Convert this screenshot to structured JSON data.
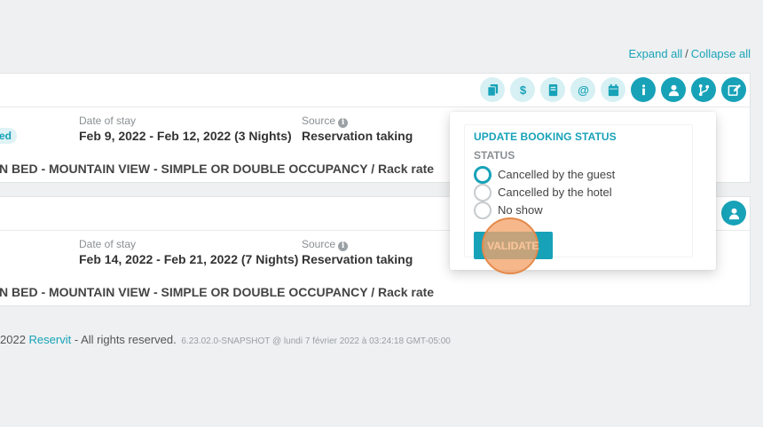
{
  "top_links": {
    "expand_all": "Expand all",
    "separator": "/",
    "collapse_all": "Collapse all"
  },
  "toolbar_icons": [
    "copy-icon",
    "dollar-icon",
    "book-icon",
    "at-icon",
    "calendar-icon",
    "info-icon",
    "user-icon",
    "branch-icon",
    "edit-icon"
  ],
  "reservations": [
    {
      "badge": "ed",
      "date_label": "Date of stay",
      "dates": "Feb 9, 2022 - Feb 12, 2022 (3 Nights)",
      "source_label": "Source",
      "source": "Reservation taking",
      "room": "N BED - MOUNTAIN VIEW - SIMPLE OR DOUBLE OCCUPANCY / Rack rate"
    },
    {
      "date_label": "Date of stay",
      "dates": "Feb 14, 2022 - Feb 21, 2022 (7 Nights)",
      "source_label": "Source",
      "source": "Reservation taking",
      "room": "N BED - MOUNTAIN VIEW - SIMPLE OR DOUBLE OCCUPANCY / Rack rate"
    }
  ],
  "footer": {
    "year": "2022",
    "brand": "Reservit",
    "rights": "- All rights reserved.",
    "version": "6.23.02.0-SNAPSHOT @ lundi 7 février 2022 à 03:24:18 GMT-05:00"
  },
  "popover": {
    "title": "UPDATE BOOKING STATUS",
    "status_label": "STATUS",
    "options": [
      {
        "label": "Cancelled by the guest",
        "checked": true
      },
      {
        "label": "Cancelled by the hotel",
        "checked": false
      },
      {
        "label": "No show",
        "checked": false
      }
    ],
    "validate_label": "VALIDATE"
  },
  "colors": {
    "accent": "#17a2b8",
    "accent_light": "#d6f0f3",
    "click_highlight": "#f4a36a"
  }
}
